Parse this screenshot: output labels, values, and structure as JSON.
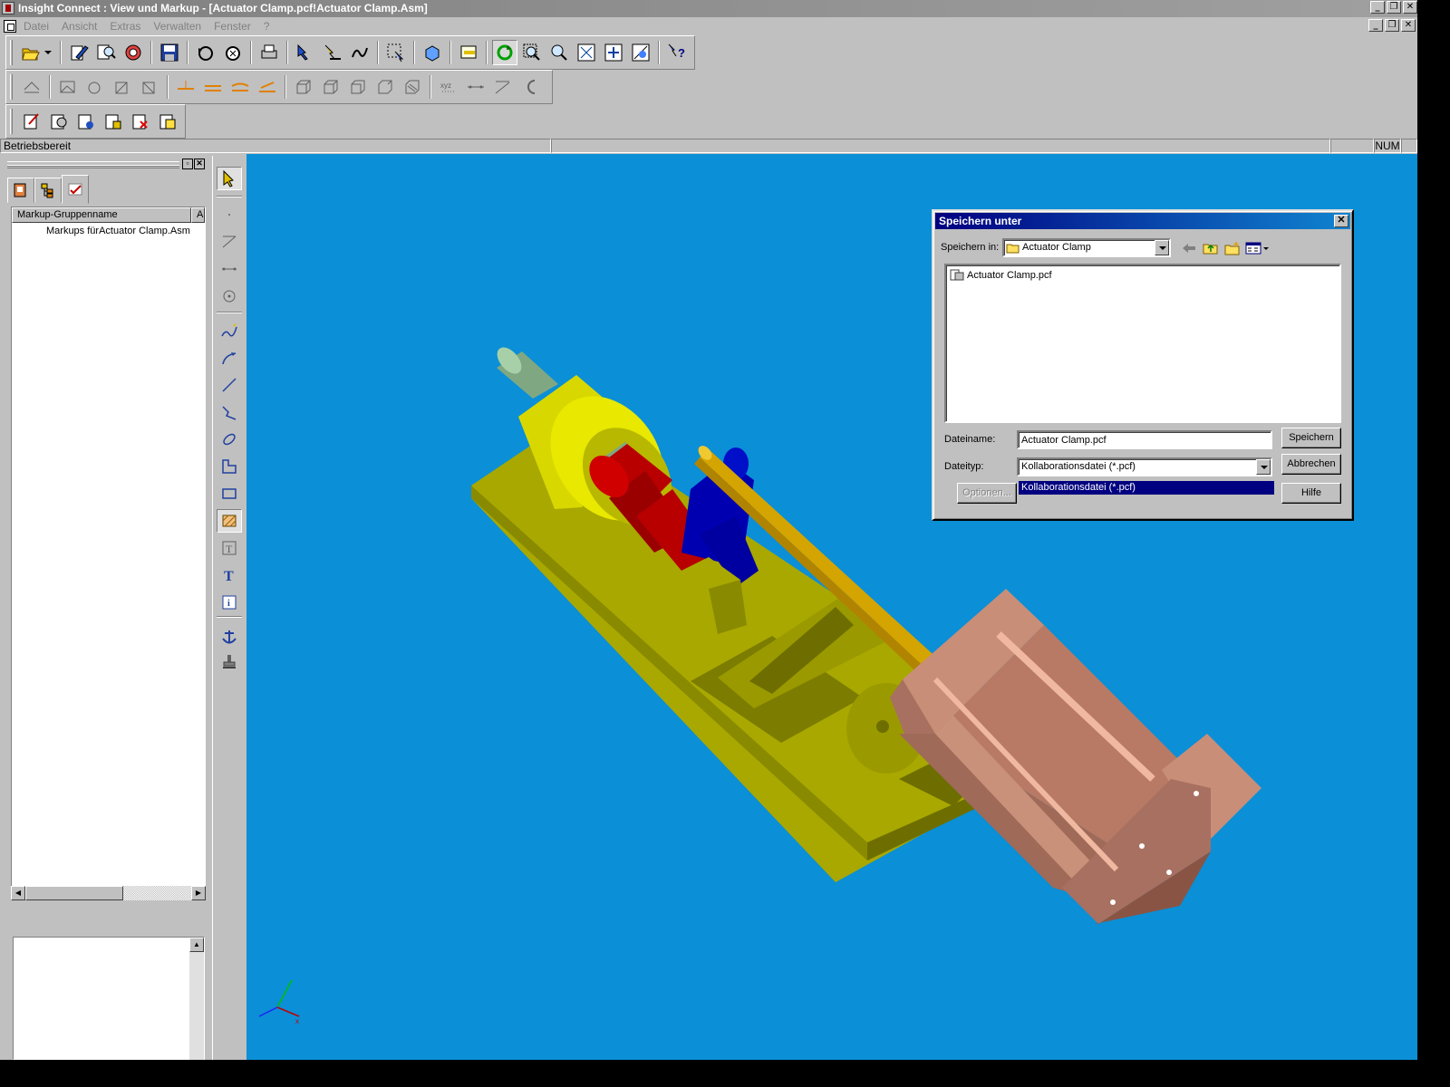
{
  "window": {
    "title": "Insight Connect : View und Markup - [Actuator Clamp.pcf!Actuator Clamp.Asm]"
  },
  "menu": [
    "Datei",
    "Ansicht",
    "Extras",
    "Verwalten",
    "Fenster",
    "?"
  ],
  "status": {
    "text": "Betriebsbereit",
    "num": "NUM"
  },
  "panel": {
    "columns": [
      "Markup-Gruppenname",
      "A"
    ],
    "rows": [
      "Markups fürActuator Clamp.Asm"
    ]
  },
  "dialog": {
    "title": "Speichern unter",
    "save_in_label": "Speichern in:",
    "save_in_value": "Actuator Clamp",
    "files": [
      "Actuator Clamp.pcf"
    ],
    "filename_label": "Dateiname:",
    "filename_value": "Actuator Clamp.pcf",
    "filetype_label": "Dateityp:",
    "filetype_value": "Kollaborationsdatei (*.pcf)",
    "filetype_options": [
      "Kollaborationsdatei (*.pcf)"
    ],
    "save_button": "Speichern",
    "cancel_button": "Abbrechen",
    "help_button": "Hilfe",
    "options_button": "Optionen..."
  },
  "colors": {
    "viewport_bg": "#0b8fd6",
    "title_active": "#000080",
    "base_yellow": "#a8a800",
    "cylinder_copper": "#c98e78",
    "link_red": "#b80000",
    "clamp_blue": "#0000b0"
  },
  "icons": {
    "main_toolbar": [
      "open-icon",
      "edit-icon",
      "zoom-icon",
      "network-icon",
      "save-icon",
      "undo-icon",
      "redo-icon",
      "print-icon",
      "markup-icon",
      "select-icon",
      "viewer-icon",
      "layers-icon",
      "rotate-icon",
      "zoom-window-icon",
      "zoom-in-icon",
      "fit-icon",
      "pan-icon",
      "perspective-icon",
      "help-icon"
    ],
    "markup_tools": [
      "arrow-select-icon",
      "point-icon",
      "line-dim-icon",
      "distance-icon",
      "circle-icon",
      "freehand-icon",
      "arrow-line-icon",
      "line-icon",
      "polyline-icon",
      "ellipse-icon",
      "polygon-icon",
      "rectangle-icon",
      "hatch-icon",
      "text-box-icon",
      "text-icon",
      "info-icon",
      "anchor-icon",
      "stamp-icon"
    ]
  }
}
